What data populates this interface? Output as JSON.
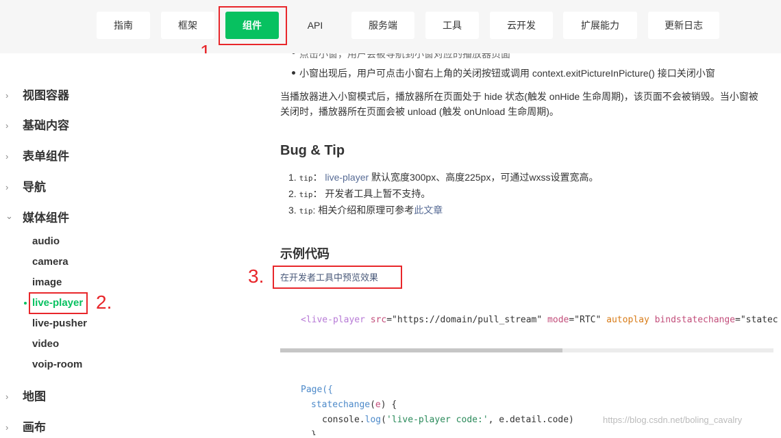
{
  "topnav": {
    "items": [
      "指南",
      "框架",
      "组件",
      "API",
      "服务端",
      "工具",
      "云开发",
      "扩展能力",
      "更新日志"
    ],
    "active_index": 2
  },
  "annotations": {
    "one": "1.",
    "two": "2.",
    "three": "3."
  },
  "sidebar": {
    "groups_top": [
      "视图容器",
      "基础内容",
      "表单组件",
      "导航",
      "媒体组件"
    ],
    "media_items": [
      "audio",
      "camera",
      "image",
      "live-player",
      "live-pusher",
      "video",
      "voip-room"
    ],
    "active_item": "live-player",
    "groups_bottom": [
      "地图",
      "画布"
    ],
    "chevron_closed": "›",
    "chevron_open": "⌄"
  },
  "content": {
    "partial_line": "点击小窗，用户会被导航到小窗对应的播放器页面",
    "bullet2": "小窗出现后，用户可点击小窗右上角的关闭按钮或调用 context.exitPictureInPicture() 接口关闭小窗",
    "para_line1": "当播放器进入小窗模式后，播放器所在页面处于 hide 状态(触发 onHide 生命周期)，该页面不会被销毁。当小窗被",
    "para_line2": "关闭时，播放器所在页面会被 unload (触发 onUnload 生命周期)。",
    "bug_title": "Bug & Tip",
    "tips": [
      {
        "num": "1.",
        "tip": "tip",
        "sep": "：",
        "link": "live-player",
        "text": " 默认宽度300px、高度225px，可通过wxss设置宽高。"
      },
      {
        "num": "2.",
        "tip": "tip",
        "sep": "：",
        "link": "",
        "text": " 开发者工具上暂不支持。"
      },
      {
        "num": "3.",
        "tip": "tip",
        "sep": ":",
        "link": "",
        "text": " 相关介绍和原理可参考",
        "link2": "此文章"
      }
    ],
    "example_title": "示例代码",
    "preview_link": "在开发者工具中预览效果",
    "code1": {
      "lt": "<",
      "tag": "live-player",
      "a1": " src",
      "v1": "=\"https://domain/pull_stream\"",
      "a2": " mode",
      "v2": "=\"RTC\"",
      "a3": " autoplay",
      "a4": " bindstatechange",
      "v4": "=\"statec"
    },
    "code2": {
      "l1": "Page({",
      "l2_fn": "statechange",
      "l2_p": "(",
      "l2_e": "e",
      "l2_r": ") {",
      "l3_a": "console.",
      "l3_fn": "log",
      "l3_b": "(",
      "l3_s": "'live-player code:'",
      "l3_c": ", e.detail.code)",
      "l4": "}"
    }
  },
  "watermark": "https://blog.csdn.net/boling_cavalry"
}
